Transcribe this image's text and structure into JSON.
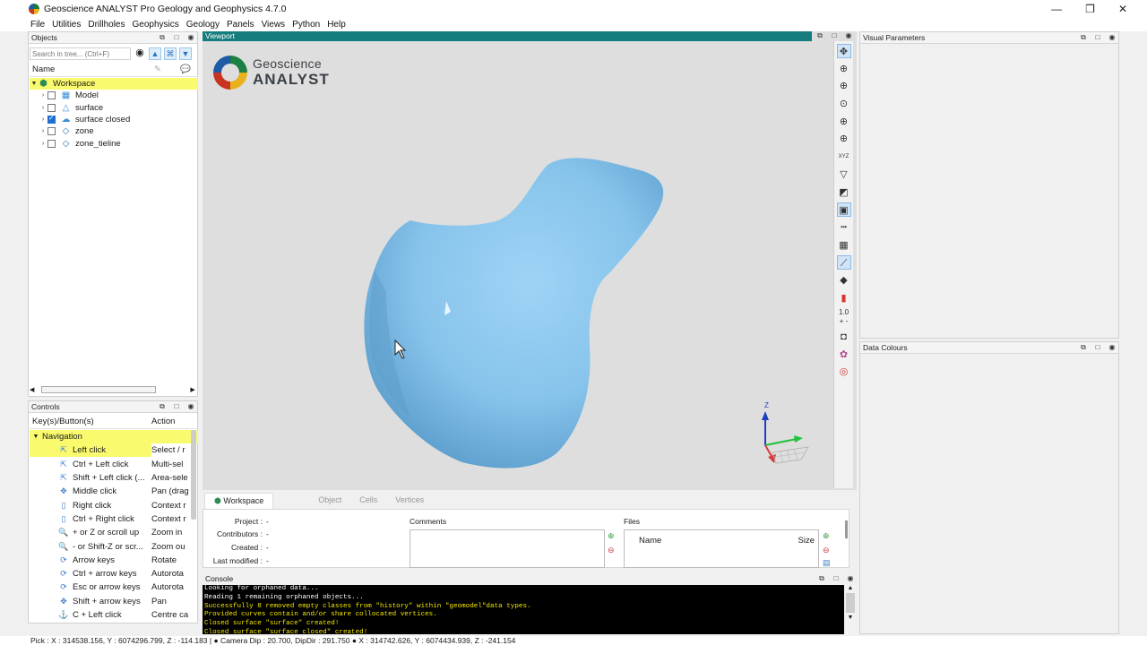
{
  "window": {
    "title": "Geoscience ANALYST Pro Geology and Geophysics 4.7.0",
    "minimize": "—",
    "maximize": "❐",
    "close": "✕"
  },
  "menu": [
    "File",
    "Utilities",
    "Drillholes",
    "Geophysics",
    "Geology",
    "Panels",
    "Views",
    "Python",
    "Help"
  ],
  "objects_panel": {
    "title": "Objects",
    "search_placeholder": "Search in tree... (Ctrl+F)",
    "column_name": "Name",
    "items": [
      {
        "label": "Workspace",
        "icon": "workspace-icon",
        "checked": null
      },
      {
        "label": "Model",
        "icon": "grid-model-icon",
        "checked": false
      },
      {
        "label": "surface",
        "icon": "surface-icon",
        "checked": false
      },
      {
        "label": "surface closed",
        "icon": "surface-closed-icon",
        "checked": true
      },
      {
        "label": "zone",
        "icon": "zone-icon",
        "checked": false
      },
      {
        "label": "zone_tieline",
        "icon": "zone-icon",
        "checked": false
      }
    ]
  },
  "controls_panel": {
    "title": "Controls",
    "col_keys": "Key(s)/Button(s)",
    "col_action": "Action",
    "group": "Navigation",
    "rows": [
      {
        "key": "Left click",
        "action": "Select / r",
        "icon": "pointer-icon"
      },
      {
        "key": "Ctrl + Left click",
        "action": "Multi-sel",
        "icon": "pointer-icon"
      },
      {
        "key": "Shift + Left click (...",
        "action": "Area-sele",
        "icon": "pointer-icon"
      },
      {
        "key": "Middle click",
        "action": "Pan (drag",
        "icon": "pan-icon"
      },
      {
        "key": "Right click",
        "action": "Context r",
        "icon": "mouse-icon"
      },
      {
        "key": "Ctrl + Right click",
        "action": "Context r",
        "icon": "mouse-icon"
      },
      {
        "key": "+ or Z or scroll up",
        "action": "Zoom in",
        "icon": "zoom-icon"
      },
      {
        "key": "- or Shift-Z or scr...",
        "action": "Zoom ou",
        "icon": "zoom-icon"
      },
      {
        "key": "Arrow keys",
        "action": "Rotate",
        "icon": "rotate-icon"
      },
      {
        "key": "Ctrl + arrow keys",
        "action": "Autorota",
        "icon": "rotate-icon"
      },
      {
        "key": "Esc or arrow keys",
        "action": "Autorota",
        "icon": "rotate-icon"
      },
      {
        "key": "Shift + arrow keys",
        "action": "Pan",
        "icon": "pan-icon"
      },
      {
        "key": "C + Left click",
        "action": "Centre ca",
        "icon": "anchor-icon"
      }
    ]
  },
  "viewport": {
    "title": "Viewport",
    "logo_line1": "Geoscience",
    "logo_line2": "ANALYST",
    "axis_label": "Z",
    "zoom_value": "1.0",
    "shape_color": "#8ec8ee"
  },
  "info": {
    "tabs": [
      "Workspace",
      "Object",
      "Cells",
      "Vertices"
    ],
    "project_label": "Project :",
    "project_value": "-",
    "contributors_label": "Contributors :",
    "contributors_value": "-",
    "created_label": "Created :",
    "created_value": "-",
    "modified_label": "Last modified :",
    "modified_value": "-",
    "comments_label": "Comments",
    "files_label": "Files",
    "files_col_name": "Name",
    "files_col_size": "Size"
  },
  "console": {
    "title": "Console",
    "lines": [
      {
        "text": "Looking for orphaned data...",
        "color": "w"
      },
      {
        "text": "Reading 1 remaining orphaned objects...",
        "color": "w"
      },
      {
        "text": "Successfully 8 removed empty classes from \"history\" within \"geomodel\"data types.",
        "color": "y"
      },
      {
        "text": "Provided curves contain and/or share collocated vertices.",
        "color": "y"
      },
      {
        "text": "Closed surface \"surface\" created!",
        "color": "y"
      },
      {
        "text": "Closed surface \"surface closed\" created!",
        "color": "y"
      }
    ]
  },
  "right_panels": {
    "visual_params": "Visual Parameters",
    "data_colours": "Data Colours"
  },
  "status": "Pick : X : 314538.156, Y : 6074296.799, Z : -114.183 |  ●  Camera Dip : 20.700, DipDir : 291.750  ●  X : 314742.626, Y : 6074434.939, Z : -241.154"
}
